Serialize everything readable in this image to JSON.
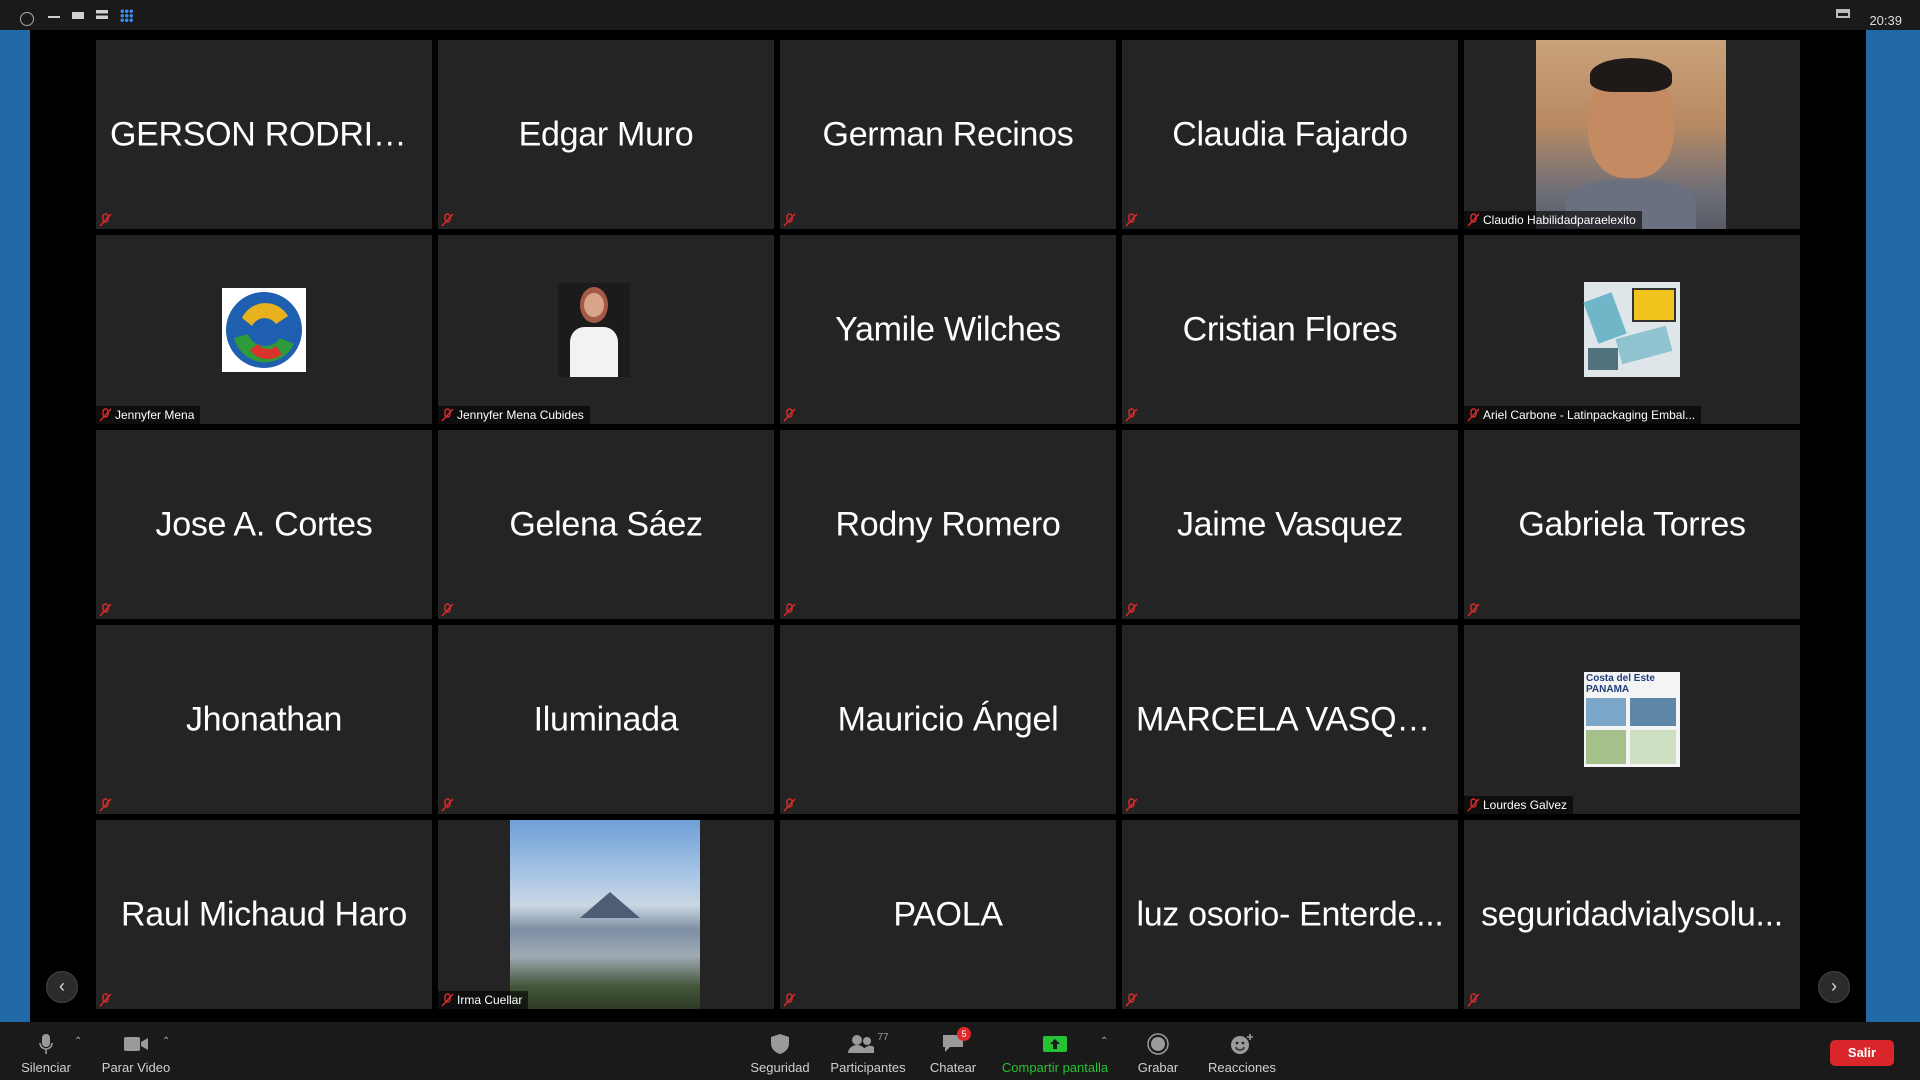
{
  "status": {
    "time": "20:39"
  },
  "participants_grid": [
    {
      "name": "GERSON RODRIG..."
    },
    {
      "name": "Edgar Muro"
    },
    {
      "name": "German Recinos"
    },
    {
      "name": "Claudia Fajardo"
    },
    {
      "label": "Claudio Habilidadparaelexito"
    },
    {
      "label": "Jennyfer Mena"
    },
    {
      "label": "Jennyfer Mena Cubides"
    },
    {
      "name": "Yamile Wilches"
    },
    {
      "name": "Cristian Flores"
    },
    {
      "label": "Ariel Carbone - Latinpackaging Embal..."
    },
    {
      "name": "Jose A. Cortes"
    },
    {
      "name": "Gelena Sáez"
    },
    {
      "name": "Rodny Romero"
    },
    {
      "name": "Jaime Vasquez"
    },
    {
      "name": "Gabriela Torres"
    },
    {
      "name": "Jhonathan"
    },
    {
      "name": "Iluminada"
    },
    {
      "name": "Mauricio Ángel"
    },
    {
      "name": "MARCELA VASQU..."
    },
    {
      "label": "Lourdes Galvez",
      "image_text": "Costa del Este PANAMA"
    },
    {
      "name": "Raul Michaud Haro"
    },
    {
      "label": "Irma Cuellar"
    },
    {
      "name": "PAOLA"
    },
    {
      "name": "luz osorio- Enterde..."
    },
    {
      "name": "seguridadvialysolu..."
    }
  ],
  "toolbar": {
    "mute": "Silenciar",
    "stop_video": "Parar Video",
    "security": "Seguridad",
    "participants": "Participantes",
    "participants_count": "77",
    "chat": "Chatear",
    "chat_badge": "5",
    "share": "Compartir pantalla",
    "record": "Grabar",
    "reactions": "Reacciones",
    "leave": "Salir"
  },
  "colors": {
    "share_green": "#25c234",
    "leave_red": "#d9262b",
    "mute_red": "#e02828"
  }
}
